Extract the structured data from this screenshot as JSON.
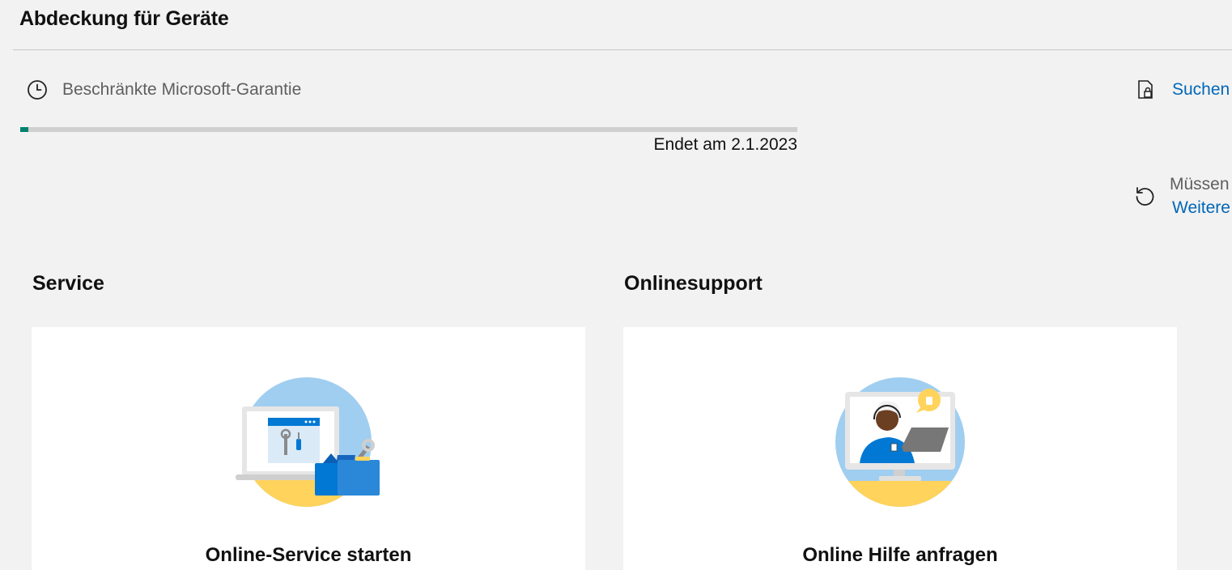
{
  "header": {
    "title": "Abdeckung für Geräte"
  },
  "warranty": {
    "label": "Beschränkte Microsoft-Garantie",
    "progress_fraction": 0.01,
    "end_date_text": "Endet am 2.1.2023",
    "icon": "clock-icon"
  },
  "right_panel": {
    "search_link": "Suchen",
    "search_icon": "document-lock-icon",
    "renew_question": "Müssen",
    "renew_link": "Weitere",
    "renew_icon": "refresh-icon"
  },
  "sections": [
    {
      "title": "Service",
      "card_caption": "Online-Service starten",
      "illustration": "laptop-toolbox-illustration"
    },
    {
      "title": "Onlinesupport",
      "card_caption": "Online Hilfe anfragen",
      "illustration": "support-agent-illustration"
    }
  ],
  "colors": {
    "background": "#f2f2f2",
    "link": "#0067b8",
    "progress_fill": "#00826e",
    "progress_track": "#cfcfcf"
  }
}
